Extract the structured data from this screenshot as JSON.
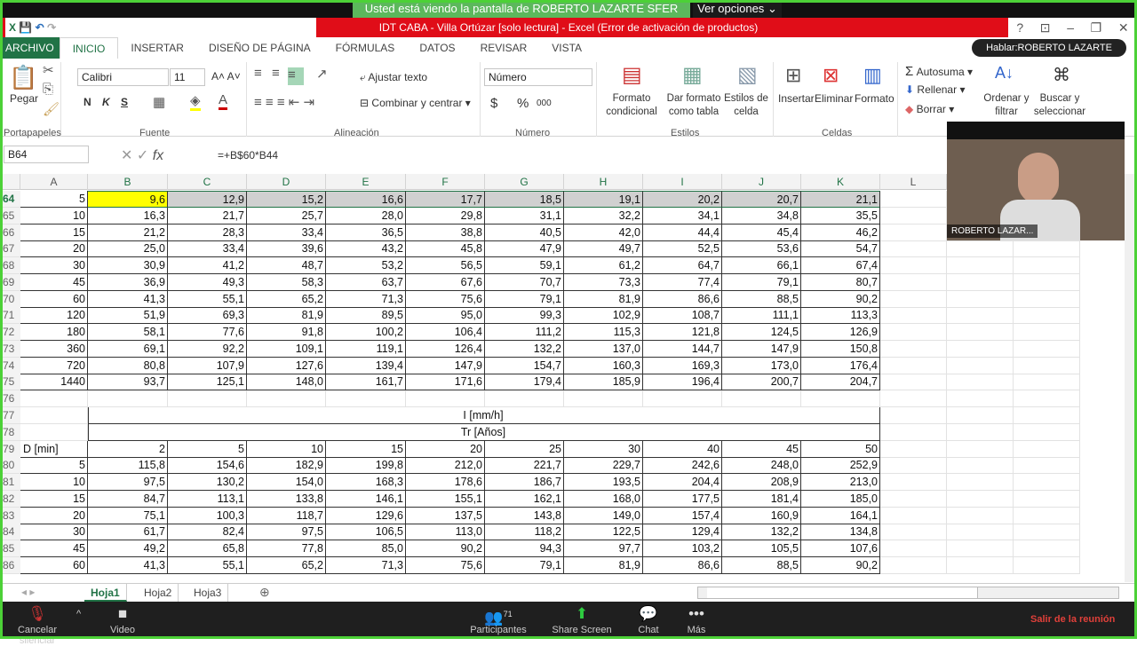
{
  "zoom": {
    "banner": "Usted está viendo la pantalla de ROBERTO LAZARTE SFER",
    "view_options": "Ver opciones",
    "speaker": "Hablar:ROBERTO LAZARTE SFER",
    "participant_name": "ROBERTO LAZAR...",
    "toolbar": {
      "mute": "Cancelar silenciar",
      "video": "Video",
      "participants": "Participantes",
      "participants_count": "71",
      "share": "Share Screen",
      "chat": "Chat",
      "more": "Más",
      "leave": "Salir de la reunión"
    }
  },
  "excel": {
    "title": "IDT CABA - Villa Ortúzar  [solo lectura] -  Excel (Error de activación de productos)",
    "tabs": [
      "ARCHIVO",
      "INICIO",
      "INSERTAR",
      "DISEÑO DE PÁGINA",
      "FÓRMULAS",
      "DATOS",
      "REVISAR",
      "VISTA"
    ],
    "ribbon": {
      "paste": "Pegar",
      "font": "Calibri",
      "size": "11",
      "bold": "N",
      "italic": "K",
      "underline": "S",
      "wrap": "Ajustar texto",
      "merge": "Combinar y centrar",
      "number_format": "Número",
      "currency": "$",
      "percent": "%",
      "thousands": "000",
      "cond_format": "Formato condicional",
      "format_table": "Dar formato como tabla",
      "cell_styles": "Estilos de celda",
      "insert": "Insertar",
      "delete": "Eliminar",
      "format": "Formato",
      "autosum": "Autosuma",
      "fill": "Rellenar",
      "clear": "Borrar",
      "sort": "Ordenar y filtrar",
      "find": "Buscar y seleccionar",
      "groups": [
        "Portapapeles",
        "Fuente",
        "Alineación",
        "Número",
        "Estilos",
        "Celdas"
      ]
    },
    "name_box": "B64",
    "formula": "=+B$60*B44",
    "columns": [
      "A",
      "B",
      "C",
      "D",
      "E",
      "F",
      "G",
      "H",
      "I",
      "J",
      "K",
      "L"
    ],
    "rows": [
      {
        "n": "64",
        "c": [
          "5",
          "9,6",
          "12,9",
          "15,2",
          "16,6",
          "17,7",
          "18,5",
          "19,1",
          "20,2",
          "20,7",
          "21,1"
        ]
      },
      {
        "n": "65",
        "c": [
          "10",
          "16,3",
          "21,7",
          "25,7",
          "28,0",
          "29,8",
          "31,1",
          "32,2",
          "34,1",
          "34,8",
          "35,5"
        ]
      },
      {
        "n": "66",
        "c": [
          "15",
          "21,2",
          "28,3",
          "33,4",
          "36,5",
          "38,8",
          "40,5",
          "42,0",
          "44,4",
          "45,4",
          "46,2"
        ]
      },
      {
        "n": "67",
        "c": [
          "20",
          "25,0",
          "33,4",
          "39,6",
          "43,2",
          "45,8",
          "47,9",
          "49,7",
          "52,5",
          "53,6",
          "54,7"
        ]
      },
      {
        "n": "68",
        "c": [
          "30",
          "30,9",
          "41,2",
          "48,7",
          "53,2",
          "56,5",
          "59,1",
          "61,2",
          "64,7",
          "66,1",
          "67,4"
        ]
      },
      {
        "n": "69",
        "c": [
          "45",
          "36,9",
          "49,3",
          "58,3",
          "63,7",
          "67,6",
          "70,7",
          "73,3",
          "77,4",
          "79,1",
          "80,7"
        ]
      },
      {
        "n": "70",
        "c": [
          "60",
          "41,3",
          "55,1",
          "65,2",
          "71,3",
          "75,6",
          "79,1",
          "81,9",
          "86,6",
          "88,5",
          "90,2"
        ]
      },
      {
        "n": "71",
        "c": [
          "120",
          "51,9",
          "69,3",
          "81,9",
          "89,5",
          "95,0",
          "99,3",
          "102,9",
          "108,7",
          "111,1",
          "113,3"
        ]
      },
      {
        "n": "72",
        "c": [
          "180",
          "58,1",
          "77,6",
          "91,8",
          "100,2",
          "106,4",
          "111,2",
          "115,3",
          "121,8",
          "124,5",
          "126,9"
        ]
      },
      {
        "n": "73",
        "c": [
          "360",
          "69,1",
          "92,2",
          "109,1",
          "119,1",
          "126,4",
          "132,2",
          "137,0",
          "144,7",
          "147,9",
          "150,8"
        ]
      },
      {
        "n": "74",
        "c": [
          "720",
          "80,8",
          "107,9",
          "127,6",
          "139,4",
          "147,9",
          "154,7",
          "160,3",
          "169,3",
          "173,0",
          "176,4"
        ]
      },
      {
        "n": "75",
        "c": [
          "1440",
          "93,7",
          "125,1",
          "148,0",
          "161,7",
          "171,6",
          "179,4",
          "185,9",
          "196,4",
          "200,7",
          "204,7"
        ]
      },
      {
        "n": "76",
        "c": []
      },
      {
        "n": "77",
        "merged": "I [mm/h]"
      },
      {
        "n": "78",
        "merged": "Tr [Años]"
      },
      {
        "n": "79",
        "c": [
          "D [min]",
          "2",
          "5",
          "10",
          "15",
          "20",
          "25",
          "30",
          "40",
          "45",
          "50"
        ]
      },
      {
        "n": "80",
        "c": [
          "5",
          "115,8",
          "154,6",
          "182,9",
          "199,8",
          "212,0",
          "221,7",
          "229,7",
          "242,6",
          "248,0",
          "252,9"
        ]
      },
      {
        "n": "81",
        "c": [
          "10",
          "97,5",
          "130,2",
          "154,0",
          "168,3",
          "178,6",
          "186,7",
          "193,5",
          "204,4",
          "208,9",
          "213,0"
        ]
      },
      {
        "n": "82",
        "c": [
          "15",
          "84,7",
          "113,1",
          "133,8",
          "146,1",
          "155,1",
          "162,1",
          "168,0",
          "177,5",
          "181,4",
          "185,0"
        ]
      },
      {
        "n": "83",
        "c": [
          "20",
          "75,1",
          "100,3",
          "118,7",
          "129,6",
          "137,5",
          "143,8",
          "149,0",
          "157,4",
          "160,9",
          "164,1"
        ]
      },
      {
        "n": "84",
        "c": [
          "30",
          "61,7",
          "82,4",
          "97,5",
          "106,5",
          "113,0",
          "118,2",
          "122,5",
          "129,4",
          "132,2",
          "134,8"
        ]
      },
      {
        "n": "85",
        "c": [
          "45",
          "49,2",
          "65,8",
          "77,8",
          "85,0",
          "90,2",
          "94,3",
          "97,7",
          "103,2",
          "105,5",
          "107,6"
        ]
      },
      {
        "n": "86",
        "c": [
          "60",
          "41,3",
          "55,1",
          "65,2",
          "71,3",
          "75,6",
          "79,1",
          "81,9",
          "86,6",
          "88,5",
          "90,2"
        ]
      }
    ],
    "sheets": [
      "Hoja1",
      "Hoja2",
      "Hoja3"
    ],
    "colors": {
      "title_bar": "#e00d18",
      "accent": "#217346",
      "selected_cell": "#ffff00",
      "zoom_green": "#5cb85c"
    }
  }
}
